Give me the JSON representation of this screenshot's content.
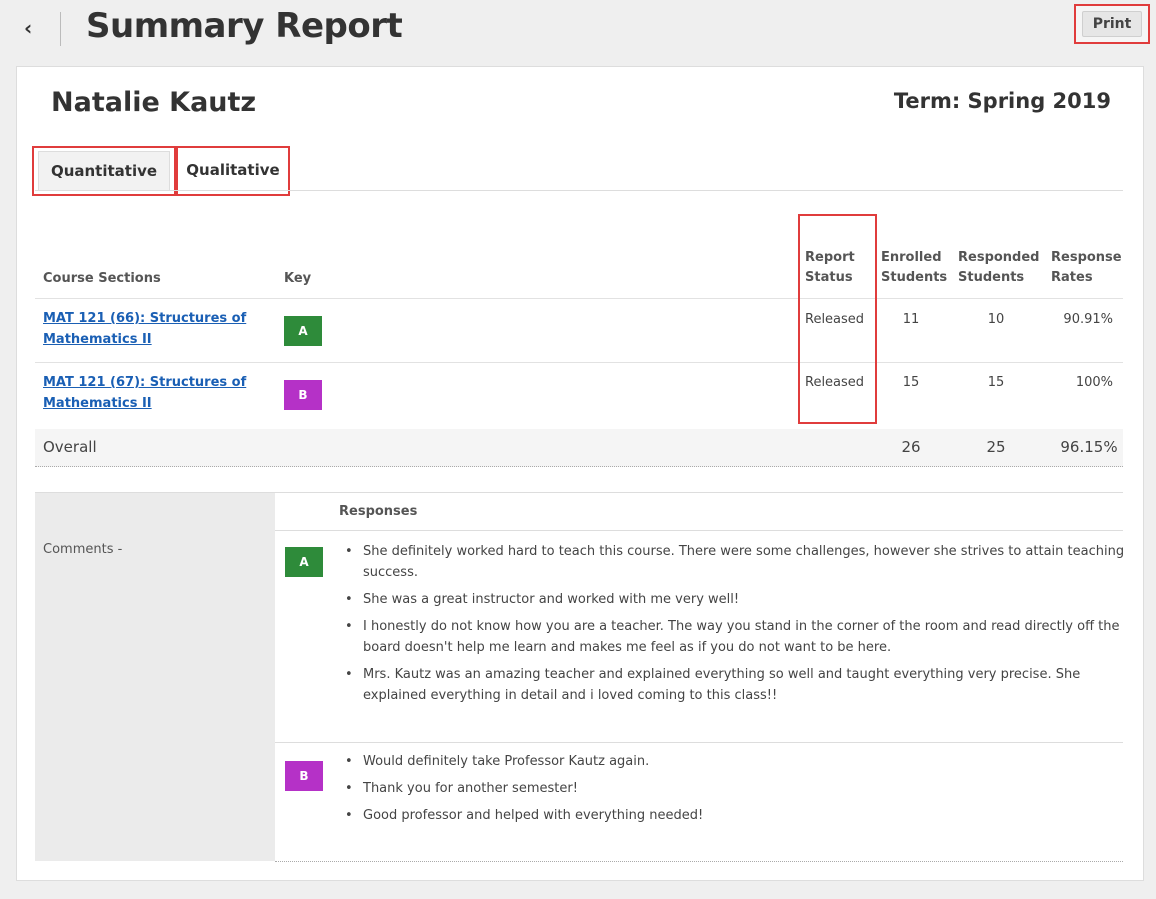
{
  "header": {
    "back_icon": "chevron-left-icon",
    "back_glyph": "‹",
    "title": "Summary Report",
    "print_label": "Print"
  },
  "instructor": {
    "name": "Natalie Kautz",
    "term": "Term: Spring 2019"
  },
  "tabs": [
    {
      "label": "Quantitative",
      "active": true
    },
    {
      "label": "Qualitative",
      "active": false
    }
  ],
  "table": {
    "headers": {
      "course": "Course Sections",
      "key": "Key",
      "status_line1": "Report",
      "status_line2": "Status",
      "enrolled_line1": "Enrolled",
      "enrolled_line2": "Students",
      "responded_line1": "Responded",
      "responded_line2": "Students",
      "rate_line1": "Response",
      "rate_line2": "Rates"
    },
    "rows": [
      {
        "course_line1": "MAT 121 (66): Structures of",
        "course_line2": "Mathematics II",
        "key": "A",
        "key_color": "#2e8b3a",
        "status": "Released",
        "enrolled": "11",
        "responded": "10",
        "rate": "90.91%"
      },
      {
        "course_line1": "MAT 121 (67): Structures of",
        "course_line2": "Mathematics II",
        "key": "B",
        "key_color": "#b531c7",
        "status": "Released",
        "enrolled": "15",
        "responded": "15",
        "rate": "100%"
      }
    ],
    "overall": {
      "label": "Overall",
      "enrolled": "26",
      "responded": "25",
      "rate": "96.15%"
    }
  },
  "comments": {
    "responses_header": "Responses",
    "label": "Comments -",
    "groups": [
      {
        "key": "A",
        "responses": [
          "She definitely worked hard to teach this course. There were some challenges, however she strives to attain teaching success.",
          "She was a great instructor and worked with me very well!",
          "I honestly do not know how you are a teacher. The way you stand in the corner of the room and read directly off the board doesn't help me learn and makes me feel as if you do not want to be here.",
          "Mrs. Kautz was an amazing teacher and explained everything so well and taught everything very precise. She explained everything in detail and i loved coming to this class!!"
        ]
      },
      {
        "key": "B",
        "responses": [
          "Would definitely take Professor Kautz again.",
          "Thank you for another semester!",
          "Good professor and helped with everything needed!"
        ]
      }
    ]
  },
  "colors": {
    "highlight": "#e03c3c",
    "link": "#1a5fb4",
    "key_a": "#2e8b3a",
    "key_b": "#b531c7"
  }
}
